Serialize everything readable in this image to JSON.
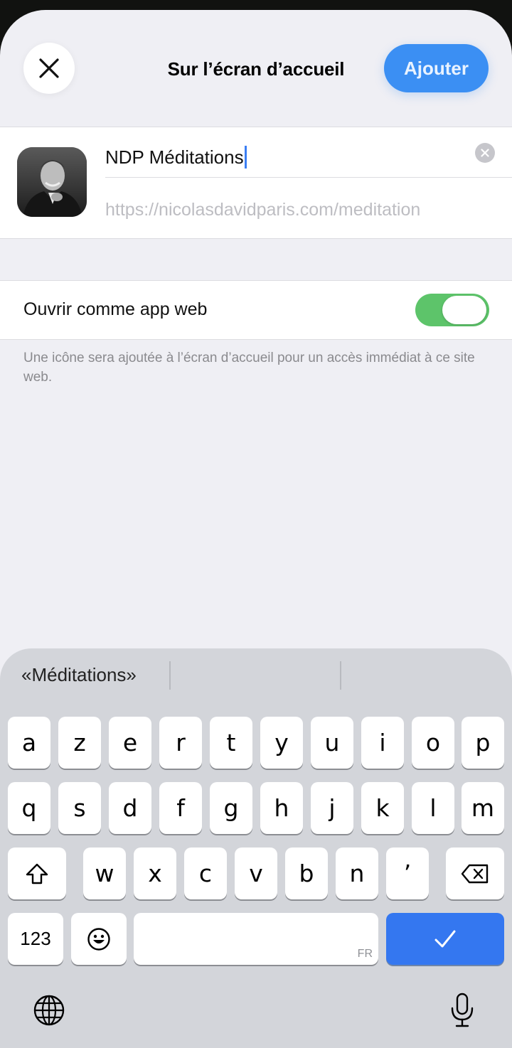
{
  "header": {
    "title": "Sur l’écran d’accueil",
    "add_label": "Ajouter"
  },
  "bookmark": {
    "name": "NDP Méditations",
    "url": "https://nicolasdavidparis.com/meditation"
  },
  "webapp": {
    "label": "Ouvrir comme app web",
    "enabled": true
  },
  "footnote": "Une icône sera ajoutée à l’écran d’accueil pour un accès immédiat à ce site web.",
  "keyboard": {
    "suggestion": "«Méditations»",
    "row1": [
      "a",
      "z",
      "e",
      "r",
      "t",
      "y",
      "u",
      "i",
      "o",
      "p"
    ],
    "row2": [
      "q",
      "s",
      "d",
      "f",
      "g",
      "h",
      "j",
      "k",
      "l",
      "m"
    ],
    "row3": [
      "w",
      "x",
      "c",
      "v",
      "b",
      "n",
      "’"
    ],
    "numbers_label": "123",
    "space_lang": "FR"
  },
  "colors": {
    "accent": "#3b8ff3",
    "toggle_on": "#5dc46a",
    "done_key": "#3477f0"
  }
}
